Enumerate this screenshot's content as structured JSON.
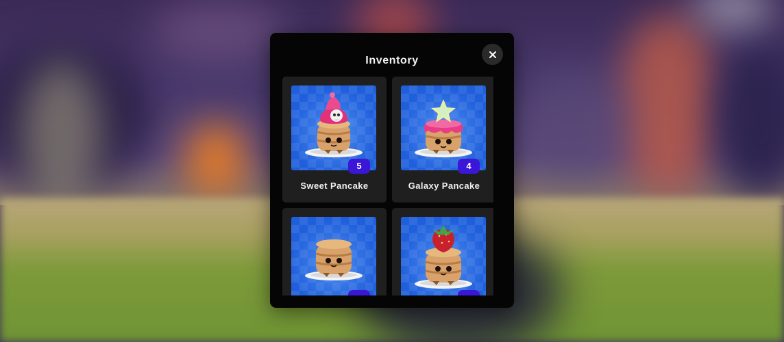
{
  "dialog": {
    "title": "Inventory",
    "close_icon": "close-icon"
  },
  "items": [
    {
      "name": "Sweet Pancake",
      "count": "5",
      "topping": "pink-frosting-skull",
      "icon": "sweet-pancake-icon"
    },
    {
      "name": "Galaxy Pancake",
      "count": "4",
      "topping": "star",
      "icon": "galaxy-pancake-icon"
    },
    {
      "name": "",
      "count": "",
      "topping": "plain",
      "icon": "plain-pancake-icon"
    },
    {
      "name": "",
      "count": "",
      "topping": "strawberry",
      "icon": "strawberry-pancake-icon"
    }
  ],
  "colors": {
    "dialog_bg": "#050505",
    "card_bg": "#1f1f1f",
    "badge_bg": "#3b16d6",
    "thumb_bg": "#1f5fdc"
  }
}
